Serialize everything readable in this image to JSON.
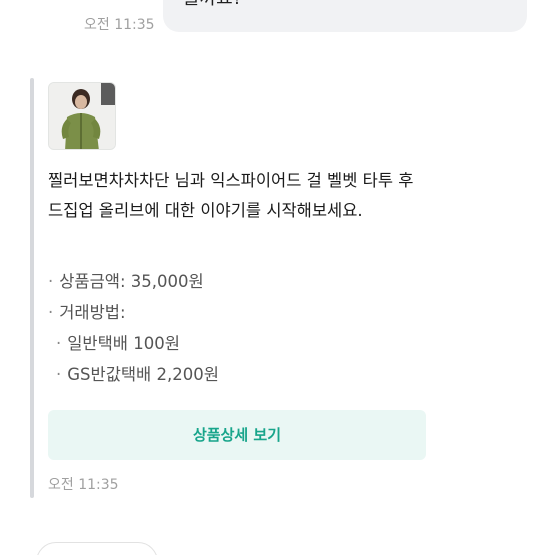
{
  "previous_message": {
    "time": "오전 11:35",
    "text": "줄까요?"
  },
  "system_message": {
    "thumbnail_icon": "product-photo",
    "intro": "찔러보면차차차단 님과 익스파이어드 걸 벨벳 타투 후드집업 올리브에 대한 이야기를 시작해보세요.",
    "price_line": "상품금액: 35,000원",
    "method_label": "거래방법:",
    "methods": [
      "일반택배 100원",
      "GS반값택배 2,200원"
    ],
    "button_label": "상품상세 보기",
    "time": "오전 11:35"
  },
  "colors": {
    "accent": "#18a58b",
    "button_bg": "#eaf7f4",
    "bubble_bg": "#f1f2f4"
  }
}
